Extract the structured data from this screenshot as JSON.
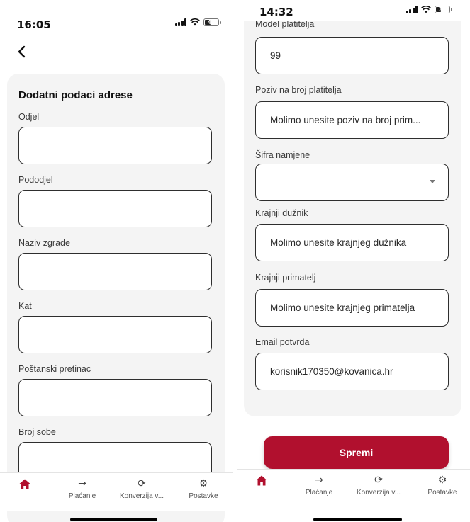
{
  "left": {
    "status": {
      "time": "16:05",
      "battery": "41"
    },
    "icons": {
      "back": "chevron-left-icon"
    },
    "section_title": "Dodatni podaci adrese",
    "fields": [
      {
        "label": "Odjel",
        "value": ""
      },
      {
        "label": "Pododjel",
        "value": ""
      },
      {
        "label": "Naziv zgrade",
        "value": ""
      },
      {
        "label": "Kat",
        "value": ""
      },
      {
        "label": "Poštanski pretinac",
        "value": ""
      },
      {
        "label": "Broj sobe",
        "value": ""
      }
    ],
    "tabs": [
      {
        "label": "",
        "icon": "home-icon"
      },
      {
        "label": "Plaćanje",
        "icon": "arrow-right-icon"
      },
      {
        "label": "Konverzija v...",
        "icon": "refresh-icon"
      },
      {
        "label": "Postavke",
        "icon": "gear-icon"
      }
    ]
  },
  "right": {
    "status": {
      "time": "14:32",
      "battery": "33"
    },
    "fields": [
      {
        "label": "Model platitelja",
        "value": "99"
      },
      {
        "label": "Poziv na broj platitelja",
        "value": "Molimo unesite poziv na broj prim..."
      },
      {
        "label": "Šifra namjene",
        "value": ""
      },
      {
        "label": "Krajnji dužnik",
        "value": "Molimo unesite krajnjeg dužnika"
      },
      {
        "label": "Krajnji primatelj",
        "value": "Molimo unesite krajnjeg primatelja"
      },
      {
        "label": "Email potvrda",
        "value": "korisnik170350@kovanica.hr"
      }
    ],
    "save_label": "Spremi",
    "tabs": [
      {
        "label": "",
        "icon": "home-icon"
      },
      {
        "label": "Plaćanje",
        "icon": "arrow-right-icon"
      },
      {
        "label": "Konverzija v...",
        "icon": "refresh-icon"
      },
      {
        "label": "Postavke",
        "icon": "gear-icon"
      }
    ]
  },
  "colors": {
    "accent": "#b1102e",
    "card_bg": "#f4f4f4",
    "field_border": "#2e2e2e"
  }
}
